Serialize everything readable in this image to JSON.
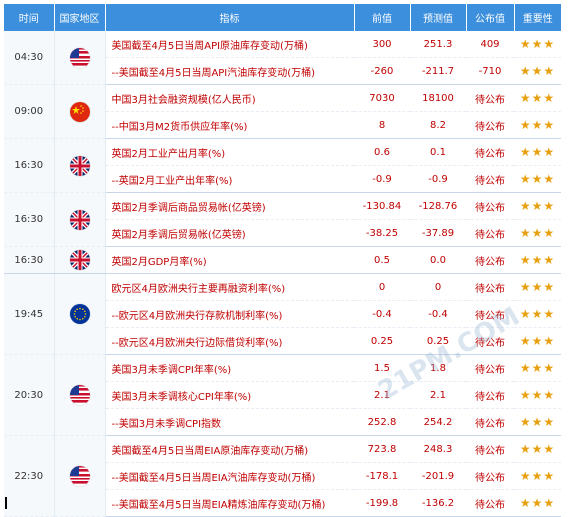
{
  "headers": {
    "time": "时间",
    "country": "国家地区",
    "indicator": "指标",
    "previous": "前值",
    "forecast": "预测值",
    "actual": "公布值",
    "importance": "重要性"
  },
  "stars": "★★★",
  "watermark": "21PM.COM",
  "groups": [
    {
      "time": "04:30",
      "flag": "us-flag-icon",
      "rows": [
        {
          "indicator": "美国截至4月5日当周API原油库存变动(万桶)",
          "previous": "300",
          "forecast": "251.3",
          "actual": "409"
        },
        {
          "indicator": "--美国截至4月5日当周API汽油库存变动(万桶)",
          "previous": "-260",
          "forecast": "-211.7",
          "actual": "-710"
        }
      ]
    },
    {
      "time": "09:00",
      "flag": "cn-flag-icon",
      "rows": [
        {
          "indicator": "中国3月社会融资规模(亿人民币)",
          "previous": "7030",
          "forecast": "18100",
          "actual": "待公布"
        },
        {
          "indicator": "--中国3月M2货币供应年率(%)",
          "previous": "8",
          "forecast": "8.2",
          "actual": "待公布"
        }
      ]
    },
    {
      "time": "16:30",
      "flag": "uk-flag-icon",
      "rows": [
        {
          "indicator": "英国2月工业产出月率(%)",
          "previous": "0.6",
          "forecast": "0.1",
          "actual": "待公布"
        },
        {
          "indicator": "--英国2月工业产出年率(%)",
          "previous": "-0.9",
          "forecast": "-0.9",
          "actual": "待公布"
        }
      ]
    },
    {
      "time": "16:30",
      "flag": "uk-flag-icon",
      "rows": [
        {
          "indicator": "英国2月季调后商品贸易帐(亿英镑)",
          "previous": "-130.84",
          "forecast": "-128.76",
          "actual": "待公布"
        },
        {
          "indicator": "英国2月季调后贸易帐(亿英镑)",
          "previous": "-38.25",
          "forecast": "-37.89",
          "actual": "待公布"
        }
      ]
    },
    {
      "time": "16:30",
      "flag": "uk-flag-icon",
      "rows": [
        {
          "indicator": "英国2月GDP月率(%)",
          "previous": "0.5",
          "forecast": "0.0",
          "actual": "待公布"
        }
      ]
    },
    {
      "time": "19:45",
      "flag": "eu-flag-icon",
      "rows": [
        {
          "indicator": "欧元区4月欧洲央行主要再融资利率(%)",
          "previous": "0",
          "forecast": "0",
          "actual": "待公布"
        },
        {
          "indicator": "--欧元区4月欧洲央行存款机制利率(%)",
          "previous": "-0.4",
          "forecast": "-0.4",
          "actual": "待公布"
        },
        {
          "indicator": "--欧元区4月欧洲央行边际借贷利率(%)",
          "previous": "0.25",
          "forecast": "0.25",
          "actual": "待公布"
        }
      ]
    },
    {
      "time": "20:30",
      "flag": "us-flag-icon",
      "rows": [
        {
          "indicator": "美国3月未季调CPI年率(%)",
          "previous": "1.5",
          "forecast": "1.8",
          "actual": "待公布"
        },
        {
          "indicator": "美国3月未季调核心CPI年率(%)",
          "previous": "2.1",
          "forecast": "2.1",
          "actual": "待公布"
        },
        {
          "indicator": "--美国3月未季调CPI指数",
          "previous": "252.8",
          "forecast": "254.2",
          "actual": "待公布"
        }
      ]
    },
    {
      "time": "22:30",
      "flag": "us-flag-icon",
      "rows": [
        {
          "indicator": "美国截至4月5日当周EIA原油库存变动(万桶)",
          "previous": "723.8",
          "forecast": "248.3",
          "actual": "待公布"
        },
        {
          "indicator": "--美国截至4月5日当周EIA汽油库存变动(万桶)",
          "previous": "-178.1",
          "forecast": "-201.9",
          "actual": "待公布"
        },
        {
          "indicator": "--美国截至4月5日当周EIA精炼油库存变动(万桶)",
          "previous": "-199.8",
          "forecast": "-136.2",
          "actual": "待公布"
        }
      ]
    }
  ]
}
